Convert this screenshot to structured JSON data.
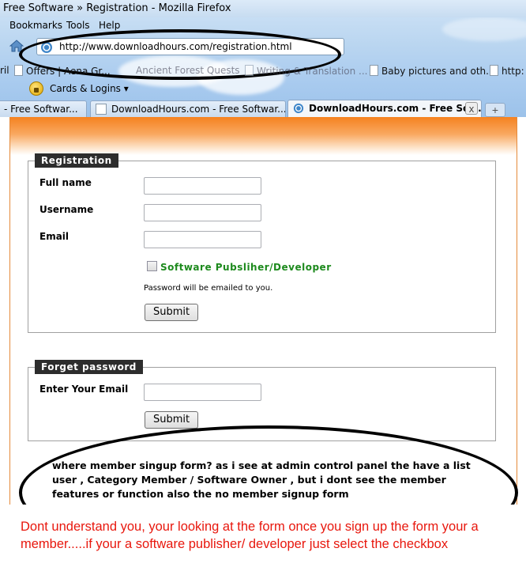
{
  "browser": {
    "window_title": "Free Software » Registration - Mozilla Firefox",
    "menu": [
      "Bookmarks",
      "Tools",
      "Help"
    ],
    "url": "http://www.downloadhours.com/registration.html",
    "bookmarks": [
      {
        "label": "ril"
      },
      {
        "label": "Offers | Aena Gr..."
      },
      {
        "label": "Ancient Forest Quests"
      },
      {
        "label": "Writing & Translation ..."
      },
      {
        "label": "Baby pictures and oth..."
      },
      {
        "label": "http:"
      }
    ],
    "cards_label": "Cards & Logins",
    "tabs": [
      {
        "label": "- Free Softwar..."
      },
      {
        "label": "DownloadHours.com - Free Softwar..."
      },
      {
        "label": "DownloadHours.com - Free Soft..."
      }
    ],
    "new_tab_label": "+",
    "close_label": "x"
  },
  "page": {
    "registration": {
      "legend": "Registration",
      "full_name_label": "Full name",
      "username_label": "Username",
      "email_label": "Email",
      "publisher_checkbox_label": "Software Pubsliher/Developer",
      "password_note": "Password will be emailed to you.",
      "submit_label": "Submit"
    },
    "forget_password": {
      "legend": "Forget password",
      "email_label": "Enter Your Email",
      "submit_label": "Submit"
    }
  },
  "annotations": {
    "question": "where member singup form? as i see at admin control panel the have a list user , Category Member / Software Owner , but i dont see the member features or function also the no member signup form",
    "answer": "Dont understand you, your looking at the form once you sign up the form your a member.....if your a software publisher/ developer just select the checkbox"
  },
  "colors": {
    "accent_orange": "#f58220",
    "legend_bg": "#2d2d2d",
    "checkbox_label": "#1d8a1d",
    "answer_text": "#e8170d"
  }
}
